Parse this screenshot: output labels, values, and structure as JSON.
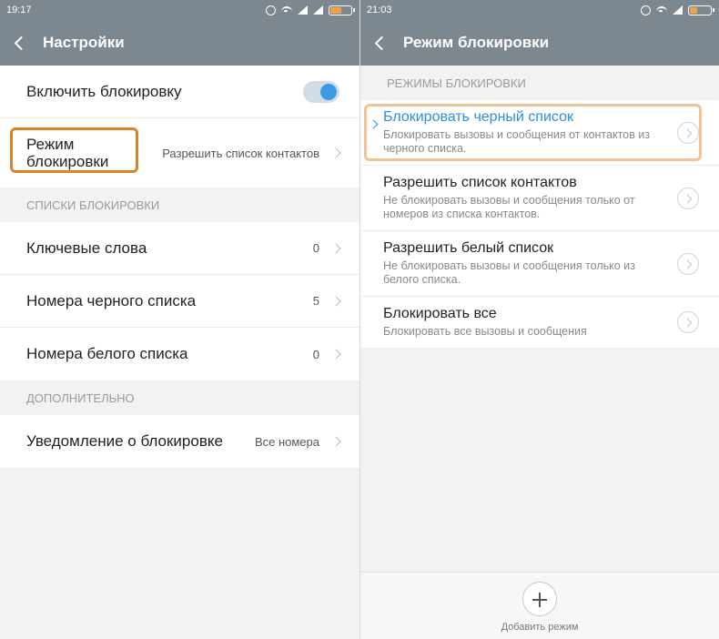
{
  "left": {
    "status": {
      "time": "19:17"
    },
    "header": {
      "title": "Настройки"
    },
    "enable_row": {
      "label": "Включить блокировку"
    },
    "mode_row": {
      "label": "Режим блокировки",
      "value": "Разрешить список контактов"
    },
    "lists_section": {
      "title": "СПИСКИ БЛОКИРОВКИ",
      "items": [
        {
          "label": "Ключевые слова",
          "value": "0"
        },
        {
          "label": "Номера черного списка",
          "value": "5"
        },
        {
          "label": "Номера белого списка",
          "value": "0"
        }
      ]
    },
    "extra_section": {
      "title": "ДОПОЛНИТЕЛЬНО",
      "items": [
        {
          "label": "Уведомление о блокировке",
          "value": "Все номера"
        }
      ]
    }
  },
  "right": {
    "status": {
      "time": "21:03"
    },
    "header": {
      "title": "Режим блокировки"
    },
    "section_title": "РЕЖИМЫ БЛОКИРОВКИ",
    "modes": [
      {
        "title": "Блокировать черный список",
        "desc": "Блокировать вызовы и сообщения от контактов из черного списка."
      },
      {
        "title": "Разрешить список контактов",
        "desc": "Не блокировать вызовы и сообщения только от номеров из списка контактов."
      },
      {
        "title": "Разрешить белый список",
        "desc": "Не блокировать вызовы и сообщения только из белого списка."
      },
      {
        "title": "Блокировать все",
        "desc": "Блокировать все вызовы и сообщения"
      }
    ],
    "add_label": "Добавить режим"
  },
  "colors": {
    "bar": "#7d8790",
    "accent": "#3d9be6",
    "highlight_left": "#d9822b",
    "highlight_right": "#f2c296"
  },
  "icons": [
    "alarm-icon",
    "wifi-icon",
    "signal-icon",
    "battery-icon",
    "back-icon",
    "chevron-icon",
    "plus-icon"
  ]
}
